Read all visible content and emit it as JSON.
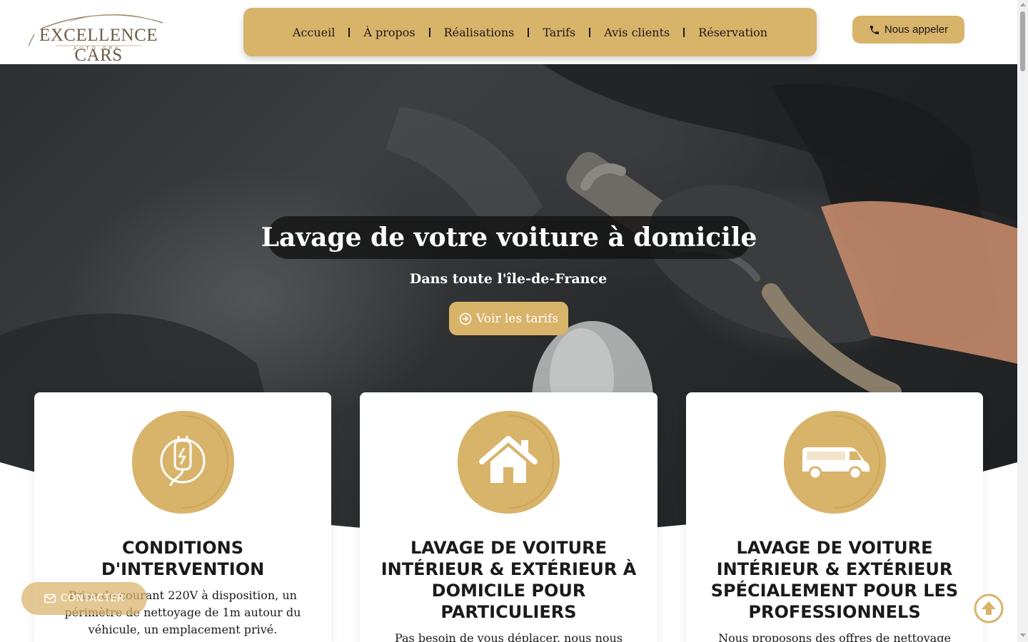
{
  "brand": {
    "name": "EXCELLENCE CARS",
    "tagline": "AUTO SPA"
  },
  "nav": {
    "items": [
      {
        "label": "Accueil"
      },
      {
        "label": "À propos"
      },
      {
        "label": "Réalisations"
      },
      {
        "label": "Tarifs"
      },
      {
        "label": "Avis clients"
      },
      {
        "label": "Réservation"
      }
    ]
  },
  "header": {
    "call_label": "Nous appeler",
    "call_icon": "phone-icon"
  },
  "hero": {
    "title": "Lavage de votre voiture à domicile",
    "subtitle": "Dans toute l'île-de-France",
    "cta_label": "Voir les tarifs",
    "cta_icon": "arrow-circle-right-icon"
  },
  "cards": [
    {
      "icon": "electric-plug-icon",
      "title": "CONDITIONS D'INTERVENTION",
      "text": "Prise de courant 220V à disposition, un périmètre de nettoyage de 1m autour du véhicule, un emplacement privé."
    },
    {
      "icon": "house-icon",
      "title": "LAVAGE DE VOITURE INTÉRIEUR & EXTÉRIEUR À DOMICILE POUR PARTICULIERS",
      "text": "Pas besoin de vous déplacer, nous nous rendons"
    },
    {
      "icon": "van-icon",
      "title": "LAVAGE DE VOITURE INTÉRIEUR & EXTÉRIEUR SPÉCIALEMENT POUR LES PROFESSIONNELS",
      "text": "Nous proposons des offres de nettoyage de"
    }
  ],
  "floating": {
    "contact_label": "CONTACTER",
    "contact_icon": "envelope-icon",
    "scroll_top_icon": "arrow-up-circle-icon"
  },
  "colors": {
    "accent": "#d8b36a",
    "dark": "#1a1a1a",
    "hero_overlay": "#2c2f31"
  }
}
